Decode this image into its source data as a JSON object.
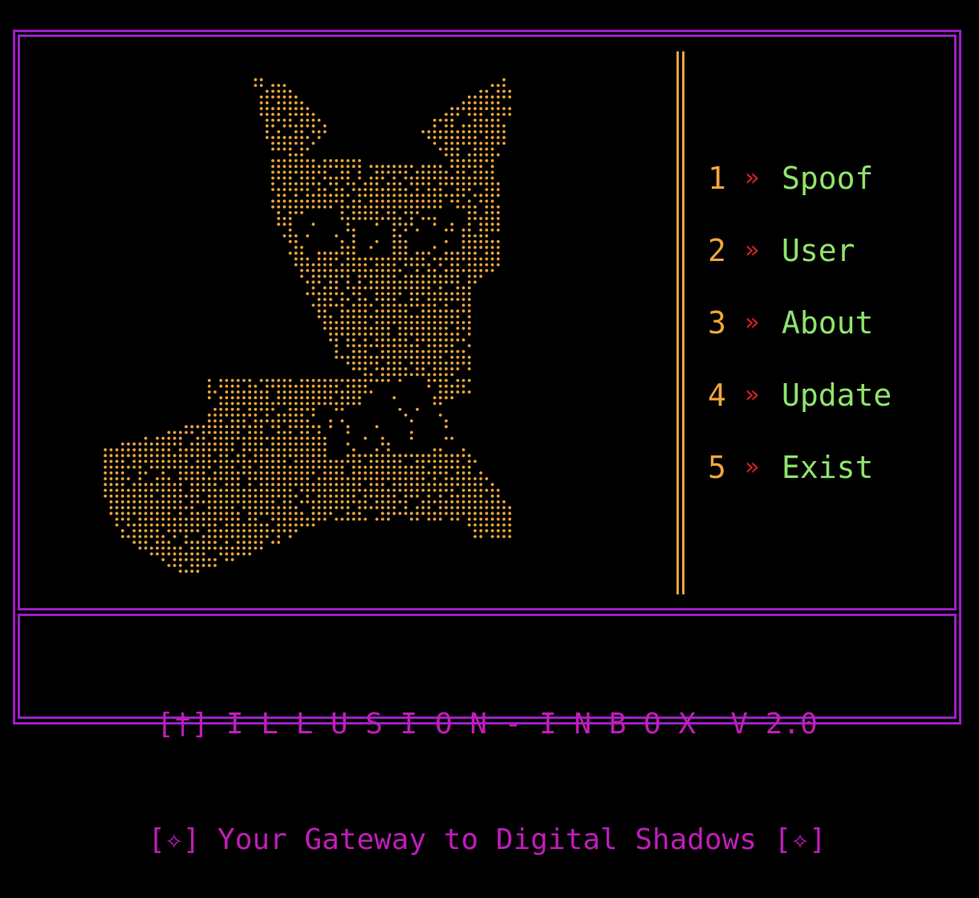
{
  "menu": {
    "items": [
      {
        "number": "1",
        "separator": "»",
        "label": "Spoof"
      },
      {
        "number": "2",
        "separator": "»",
        "label": "User"
      },
      {
        "number": "3",
        "separator": "»",
        "label": "About"
      },
      {
        "number": "4",
        "separator": "»",
        "label": "Update"
      },
      {
        "number": "5",
        "separator": "»",
        "label": "Exist"
      }
    ]
  },
  "banner": {
    "title": "[†] I L L U S I O N - I N B O X  V 2.0",
    "tagline": "[✧] Your Gateway to Digital Shadows [✧]"
  },
  "colors": {
    "frame": "#9b1fc4",
    "art": "#e8a43a",
    "number": "#f0a63c",
    "separator": "#d42121",
    "label": "#8fe36c",
    "banner": "#c01db7",
    "background": "#000000"
  },
  "art": {
    "icon": "fox-ascii-art"
  }
}
